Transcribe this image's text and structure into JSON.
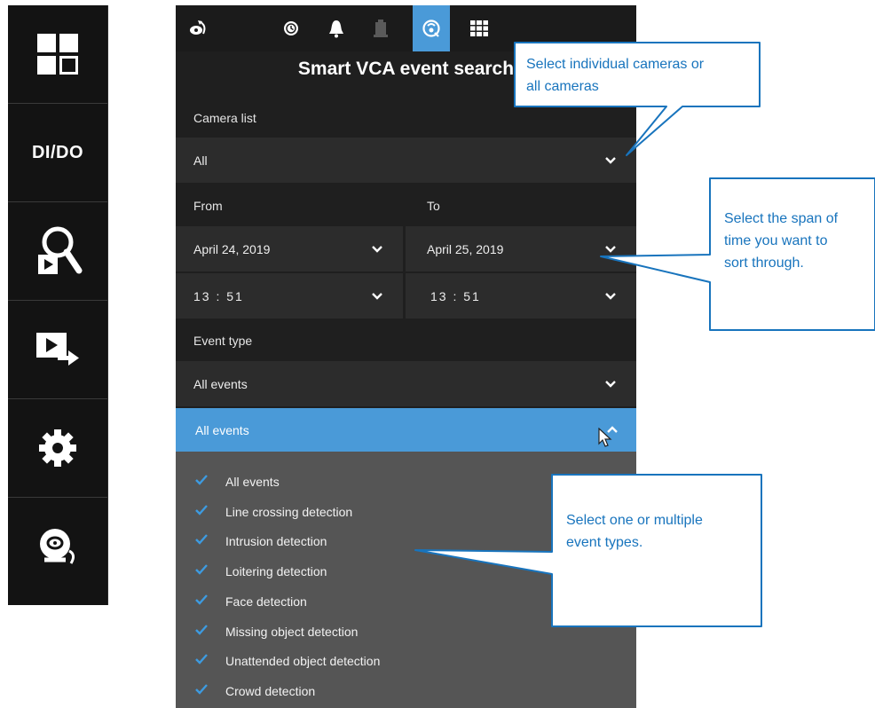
{
  "sidebar": {
    "items": [
      {
        "icon": "layout-grid-icon"
      },
      {
        "label": "DI/DO"
      },
      {
        "icon": "search-playback-icon"
      },
      {
        "icon": "export-video-icon"
      },
      {
        "icon": "gear-icon"
      },
      {
        "icon": "alarm-bell-icon"
      }
    ]
  },
  "topbar": {
    "icons": [
      "rotate-camera-icon",
      "clock-icon",
      "bell-icon",
      "dimmed-building-icon",
      "smart-vca-icon",
      "grid-icon"
    ],
    "active_index": 4,
    "accent": "#4a9ad8"
  },
  "panel": {
    "title": "Smart VCA event search",
    "camera_list_label": "Camera list",
    "camera_value": "All",
    "from_label": "From",
    "to_label": "To",
    "from_date": "April 24, 2019",
    "to_date": "April 25, 2019",
    "from_time": "13 : 51",
    "to_time": "13 : 51",
    "event_type_label": "Event type",
    "event_value": "All events",
    "event_open_value": "All events"
  },
  "event_options": [
    {
      "label": "All events",
      "checked": true
    },
    {
      "label": "Line crossing detection",
      "checked": true
    },
    {
      "label": "Intrusion detection",
      "checked": true
    },
    {
      "label": "Loitering detection",
      "checked": true
    },
    {
      "label": "Face detection",
      "checked": true
    },
    {
      "label": "Missing object detection",
      "checked": true
    },
    {
      "label": "Unattended object detection",
      "checked": true
    },
    {
      "label": "Crowd detection",
      "checked": true
    }
  ],
  "callouts": {
    "cameras": [
      "Select individual cameras or",
      "all cameras"
    ],
    "timespan": [
      "Select the span of",
      "time you want to",
      "sort through."
    ],
    "events": [
      "Select one or multiple",
      "event types."
    ],
    "color": "#1874bd"
  }
}
